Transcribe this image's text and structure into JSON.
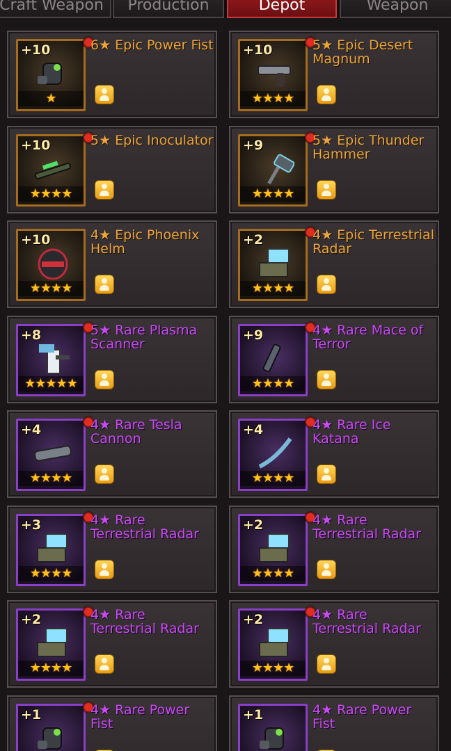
{
  "tabs": [
    {
      "label": "Craft Weapon",
      "active": false
    },
    {
      "label": "Production",
      "active": false
    },
    {
      "label": "Depot",
      "active": true
    },
    {
      "label": "Weapon",
      "active": false
    }
  ],
  "items": [
    {
      "name": "6★ Epic Power Fist",
      "level": "+10",
      "stars": "★",
      "rarity": "epic",
      "icon": "power-fist-icon",
      "new": true
    },
    {
      "name": "5★ Epic Desert Magnum",
      "level": "+10",
      "stars": "★★★★",
      "rarity": "epic",
      "icon": "magnum-icon",
      "new": true
    },
    {
      "name": "5★ Epic Inoculator",
      "level": "+10",
      "stars": "★★★★",
      "rarity": "epic",
      "icon": "inoculator-icon",
      "new": true
    },
    {
      "name": "5★ Epic Thunder Hammer",
      "level": "+9",
      "stars": "★★★★",
      "rarity": "epic",
      "icon": "thunder-hammer-icon",
      "new": true
    },
    {
      "name": "4★ Epic Phoenix Helm",
      "level": "+10",
      "stars": "★★★★",
      "rarity": "epic",
      "icon": "helm-icon",
      "new": false
    },
    {
      "name": "4★ Epic Terrestrial Radar",
      "level": "+2",
      "stars": "★★★★",
      "rarity": "epic",
      "icon": "radar-icon",
      "new": true
    },
    {
      "name": "5★ Rare Plasma Scanner",
      "level": "+8",
      "stars": "★★★★★",
      "rarity": "rare",
      "icon": "plasma-scanner-icon",
      "new": true
    },
    {
      "name": "4★ Rare Mace of Terror",
      "level": "+9",
      "stars": "★★★★",
      "rarity": "rare",
      "icon": "mace-icon",
      "new": true
    },
    {
      "name": "4★ Rare Tesla Cannon",
      "level": "+4",
      "stars": "★★★★",
      "rarity": "rare",
      "icon": "cannon-icon",
      "new": true
    },
    {
      "name": "4★ Rare Ice Katana",
      "level": "+4",
      "stars": "★★★★",
      "rarity": "rare",
      "icon": "katana-icon",
      "new": true
    },
    {
      "name": "4★ Rare Terrestrial Radar",
      "level": "+3",
      "stars": "★★★★",
      "rarity": "rare",
      "icon": "radar-icon",
      "new": true
    },
    {
      "name": "4★ Rare Terrestrial Radar",
      "level": "+2",
      "stars": "★★★★",
      "rarity": "rare",
      "icon": "radar-icon",
      "new": true
    },
    {
      "name": "4★ Rare Terrestrial Radar",
      "level": "+2",
      "stars": "★★★★",
      "rarity": "rare",
      "icon": "radar-icon",
      "new": true
    },
    {
      "name": "4★ Rare Terrestrial Radar",
      "level": "+2",
      "stars": "★★★★",
      "rarity": "rare",
      "icon": "radar-icon",
      "new": true
    },
    {
      "name": "4★ Rare Power Fist",
      "level": "+1",
      "stars": "",
      "rarity": "rare",
      "icon": "power-fist-icon",
      "new": true
    },
    {
      "name": "4★ Rare Power Fist",
      "level": "+1",
      "stars": "",
      "rarity": "rare",
      "icon": "power-fist-icon",
      "new": false
    }
  ]
}
